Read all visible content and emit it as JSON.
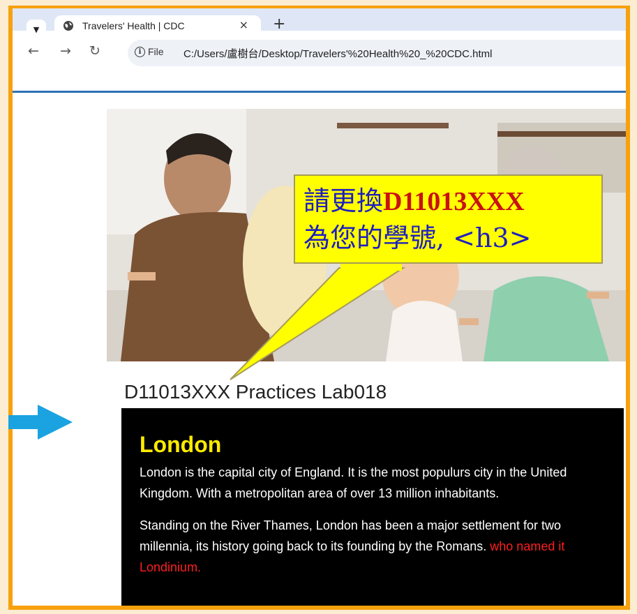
{
  "browser": {
    "tab_title": "Travelers' Health | CDC",
    "close_glyph": "×",
    "new_tab_glyph": "+",
    "file_label": "File",
    "url": "C:/Users/盧樹台/Desktop/Travelers'%20Health%20_%20CDC.html"
  },
  "page": {
    "heading": "D11013XXX Practices Lab018",
    "card": {
      "title": "London",
      "para1": "London is the capital city of England. It is the most populurs city in the United Kingdom. With a metropolitan area of over 13 million inhabitants.",
      "para2_main": "Standing on the River Thames, London has been a major settlement for two millennia, its history going back to its founding by the Romans.",
      "para2_red": "who named it Londinium."
    }
  },
  "annotation": {
    "line1_prefix": "請更換",
    "line1_bold": "D11013XXX",
    "line2": "為您的學號, <h3>"
  },
  "colors": {
    "frame": "#f7a10e",
    "callout_bg": "#ffff00",
    "card_title": "#ffeb00",
    "red_text": "#ff1e1e",
    "arrow": "#1aa3e0"
  },
  "icons": [
    "chevron-down-icon",
    "globe-icon",
    "close-icon",
    "plus-icon",
    "back-arrow-icon",
    "forward-arrow-icon",
    "reload-icon",
    "info-icon",
    "right-arrow-icon"
  ]
}
